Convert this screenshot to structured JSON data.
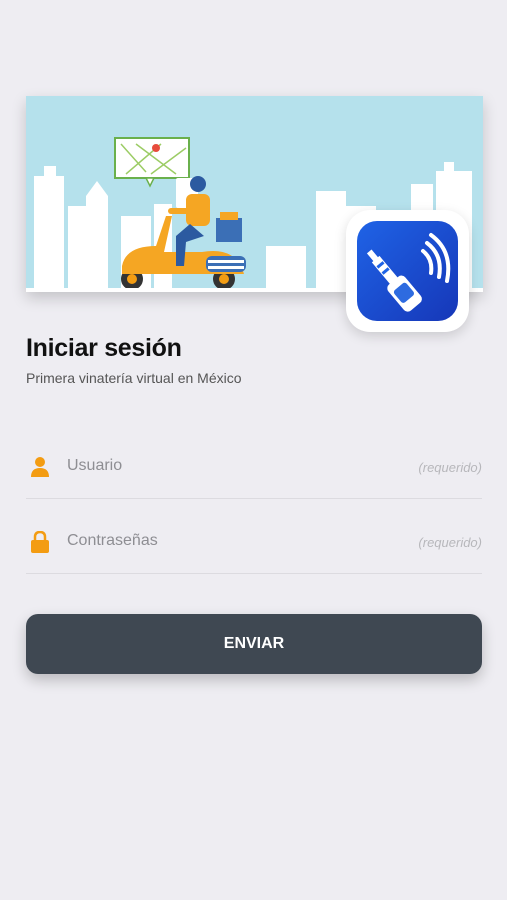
{
  "banner": {
    "illustration": "delivery-scooter-city"
  },
  "app_icon": {
    "name": "wine-bottle-wireless-icon",
    "color": "#1e4fd8"
  },
  "login": {
    "title": "Iniciar sesión",
    "subtitle": "Primera vinatería virtual en México"
  },
  "form": {
    "username": {
      "placeholder": "Usuario",
      "hint": "(requerido)",
      "icon": "user-icon"
    },
    "password": {
      "placeholder": "Contraseñas",
      "hint": "(requerido)",
      "icon": "lock-icon"
    },
    "submit_label": "ENVIAR"
  },
  "colors": {
    "accent": "#f39c12",
    "button": "#3f4852",
    "background": "#eeedf2"
  }
}
